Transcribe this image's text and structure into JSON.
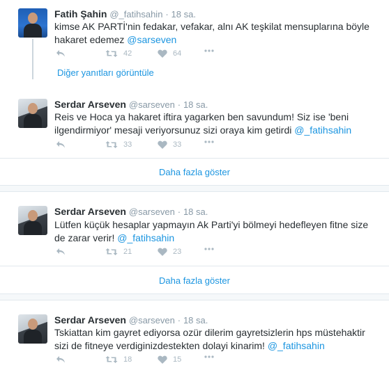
{
  "tweets": [
    {
      "name": "Fatih Şahin",
      "handle": "@_fatihsahin",
      "time": "18 sa.",
      "text": "kimse AK PARTİ'nin fedakar, vefakar, alnı AK teşkilat mensuplarına böyle hakaret edemez ",
      "mention": "@sarseven",
      "retweets": "42",
      "likes": "64",
      "avatar": "fatih-sahin-avatar"
    },
    {
      "name": "Serdar Arseven",
      "handle": "@sarseven",
      "time": "18 sa.",
      "text": "Reis ve Hoca ya hakaret iftira yagarken ben savundum! Siz ise 'beni ilgendirmiyor' mesaji veriyorsunuz sizi oraya kim getirdi  ",
      "mention": "@_fatihsahin",
      "retweets": "33",
      "likes": "33",
      "avatar": "serdar-arseven-avatar"
    },
    {
      "name": "Serdar Arseven",
      "handle": "@sarseven",
      "time": "18 sa.",
      "text": "Lütfen küçük hesaplar yapmayın Ak Parti'yi bölmeyi hedefleyen fitne size de zarar verir! ",
      "mention": "@_fatihsahin",
      "retweets": "21",
      "likes": "23",
      "avatar": "serdar-arseven-avatar"
    },
    {
      "name": "Serdar Arseven",
      "handle": "@sarseven",
      "time": "18 sa.",
      "text": "Tskiattan kim gayret ediyorsa ozür dilerim gayretsizlerin hps müstehaktir sizi de fitneye verdiginizdestekten dolayi kinarim! ",
      "mention": "@_fatihsahin",
      "retweets": "18",
      "likes": "15",
      "avatar": "serdar-arseven-avatar"
    }
  ],
  "thread": {
    "replies_link": "Diğer yanıtları görüntüle"
  },
  "more_link": "Daha fazla göster",
  "dot": "·",
  "icons": {
    "reply": "reply-icon",
    "retweet": "retweet-icon",
    "like": "heart-icon",
    "more": "more-icon"
  },
  "colors": {
    "link": "#1b95e0",
    "muted": "#8899a6",
    "icon": "#aab8c2"
  }
}
